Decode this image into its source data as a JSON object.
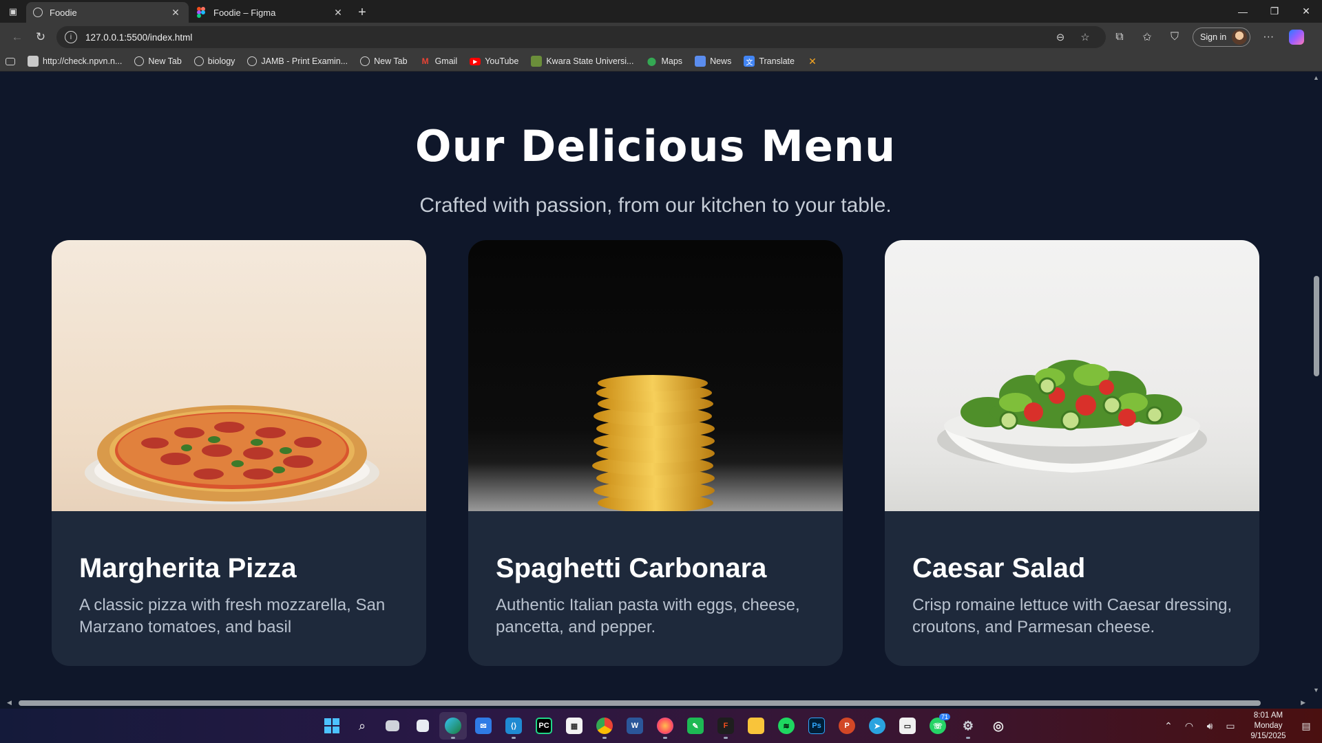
{
  "browser": {
    "tabs": [
      {
        "title": "Foodie",
        "active": true
      },
      {
        "title": "Foodie – Figma",
        "active": false
      }
    ],
    "url": "127.0.0.1:5500/index.html",
    "sign_in_label": "Sign in",
    "bookmarks": [
      {
        "label": "http://check.npvn.n...",
        "icon": "page-icon"
      },
      {
        "label": "New Tab",
        "icon": "globe-icon"
      },
      {
        "label": "biology",
        "icon": "globe-icon"
      },
      {
        "label": "JAMB - Print Examin...",
        "icon": "globe-icon"
      },
      {
        "label": "New Tab",
        "icon": "globe-icon"
      },
      {
        "label": "Gmail",
        "icon": "gmail-icon"
      },
      {
        "label": "YouTube",
        "icon": "youtube-icon"
      },
      {
        "label": "Kwara State Universi...",
        "icon": "university-icon"
      },
      {
        "label": "Maps",
        "icon": "maps-icon"
      },
      {
        "label": "News",
        "icon": "news-icon"
      },
      {
        "label": "Translate",
        "icon": "translate-icon"
      }
    ]
  },
  "page": {
    "title": "Our Delicious Menu",
    "subtitle": "Crafted with passion, from our kitchen to your table.",
    "menu": [
      {
        "name": "Margherita Pizza",
        "description": "A classic pizza with fresh mozzarella, San Marzano tomatoes, and basil"
      },
      {
        "name": "Spaghetti Carbonara",
        "description": "Authentic Italian pasta with eggs, cheese, pancetta, and pepper."
      },
      {
        "name": "Caesar Salad",
        "description": "Crisp romaine lettuce with Caesar dressing, croutons, and Parmesan cheese."
      }
    ]
  },
  "taskbar": {
    "whatsapp_badge": "71",
    "clock": {
      "time": "8:01 AM",
      "day": "Monday",
      "date": "9/15/2025"
    }
  }
}
